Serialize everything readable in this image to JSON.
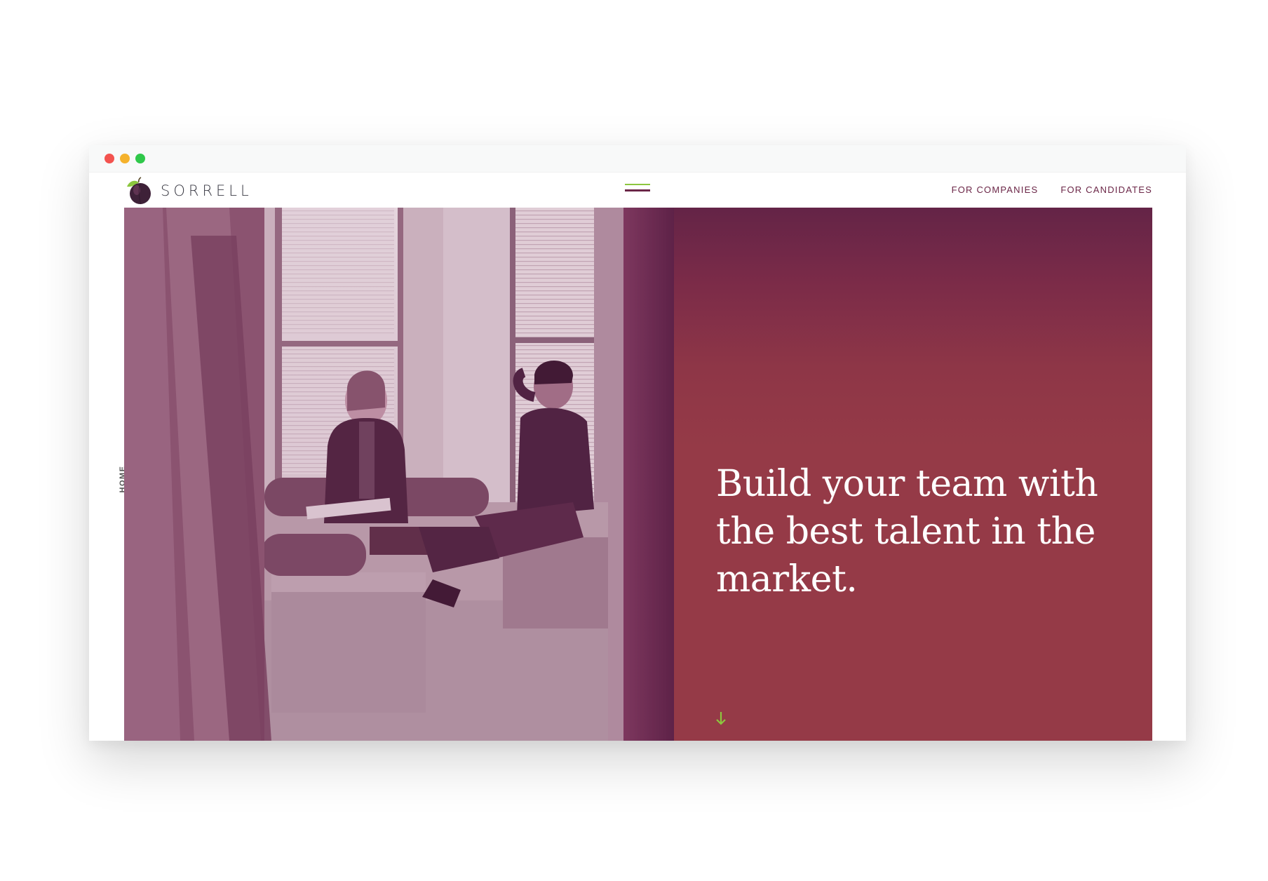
{
  "brand": {
    "name": "SORRELL"
  },
  "nav": {
    "items": [
      {
        "label": "FOR COMPANIES"
      },
      {
        "label": "FOR CANDIDATES"
      }
    ]
  },
  "side_label": "HOME",
  "hero": {
    "headline": "Build your team with the best talent in the market."
  },
  "colors": {
    "brand_plum": "#6b2647",
    "accent_green": "#8cc63e",
    "panel_red": "#953a47",
    "panel_top": "#642447"
  },
  "icons": {
    "menu": "hamburger-menu-icon",
    "scroll": "arrow-down-icon",
    "logo": "plum-icon"
  }
}
